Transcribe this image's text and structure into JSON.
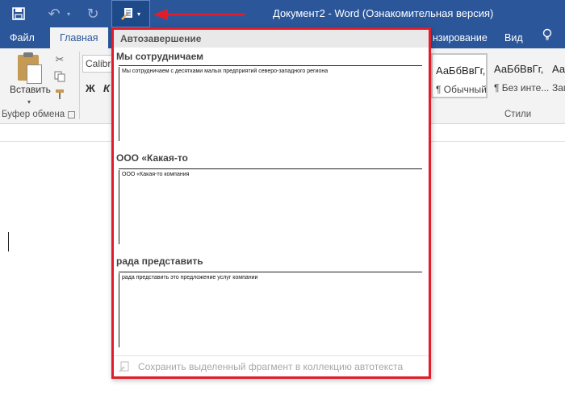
{
  "titlebar": {
    "title": "Документ2 - Word (Ознакомительная версия)",
    "icons": {
      "save": "save-icon",
      "undo": "undo-icon",
      "redo": "redo-icon",
      "autotext": "autotext-icon"
    }
  },
  "tabs": {
    "file": "Файл",
    "home": "Главная",
    "review_partial": "нзирование",
    "view": "Вид"
  },
  "ribbon": {
    "paste_label": "Вставить",
    "clipboard_group": "Буфер обмена",
    "font_name": "Calibri",
    "bold_label": "Ж",
    "italic_label": "К",
    "styles_group": "Стили",
    "styles": [
      {
        "sample": "АаБбВвГг,",
        "name": "¶ Обычный"
      },
      {
        "sample": "АаБбВвГг,",
        "name": "¶ Без инте..."
      },
      {
        "sample": "Ааl",
        "name": "Заг"
      }
    ]
  },
  "autotext": {
    "header": "Автозавершение",
    "entries": [
      {
        "name": "Мы сотрудничаем",
        "preview": "Мы сотрудничаем с десятками малых предприятий северо-западного региона"
      },
      {
        "name": "ООО «Какая-то",
        "preview": "ООО «Какая-то компания"
      },
      {
        "name": "рада представить",
        "preview": "рада представить это предложение услуг компании"
      }
    ],
    "footer": "Сохранить выделенный фрагмент в коллекцию автотекста"
  },
  "colors": {
    "word_blue": "#2b579a",
    "highlight_red": "#e21d2b"
  }
}
